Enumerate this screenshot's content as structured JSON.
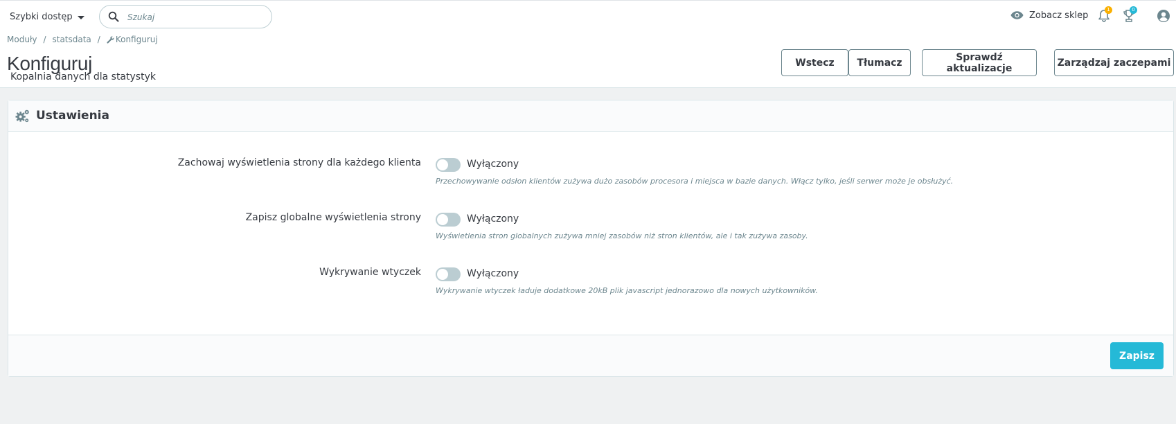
{
  "header": {
    "quick_access_label": "Szybki dostęp",
    "search_placeholder": "Szukaj",
    "view_shop_label": "Zobacz sklep",
    "notifications_badge": "1",
    "trophy_badge": "0"
  },
  "breadcrumb": {
    "items": [
      "Moduły",
      "statsdata",
      "Konfiguruj"
    ]
  },
  "page": {
    "title": "Konfiguruj",
    "subtitle": "Kopalnia danych dla statystyk"
  },
  "toolbar": {
    "back_label": "Wstecz",
    "translate_label": "Tłumacz",
    "check_updates_label": "Sprawdź aktualizacje",
    "manage_hooks_label": "Zarządzaj zaczepami"
  },
  "panel": {
    "heading": "Ustawienia",
    "fields": [
      {
        "label": "Zachowaj wyświetlenia strony dla każdego klienta",
        "state": "Wyłączony",
        "help": "Przechowywanie odsłon klientów zużywa dużo zasobów procesora i miejsca w bazie danych. Włącz tylko, jeśli serwer może je obsłużyć."
      },
      {
        "label": "Zapisz globalne wyświetlenia strony",
        "state": "Wyłączony",
        "help": "Wyświetlenia stron globalnych zużywa mniej zasobów niż stron klientów, ale i tak zużywa zasoby."
      },
      {
        "label": "Wykrywanie wtyczek",
        "state": "Wyłączony",
        "help": "Wykrywanie wtyczek ładuje dodatkowe 20kB plik javascript jednorazowo dla nowych użytkowników."
      }
    ],
    "save_label": "Zapisz"
  },
  "colors": {
    "accent": "#25b9d7",
    "text": "#363a41",
    "muted": "#6c868e",
    "switch_off": "#bbcdd2",
    "badge_warning": "#fab000",
    "badge_info": "#25b9d7"
  }
}
